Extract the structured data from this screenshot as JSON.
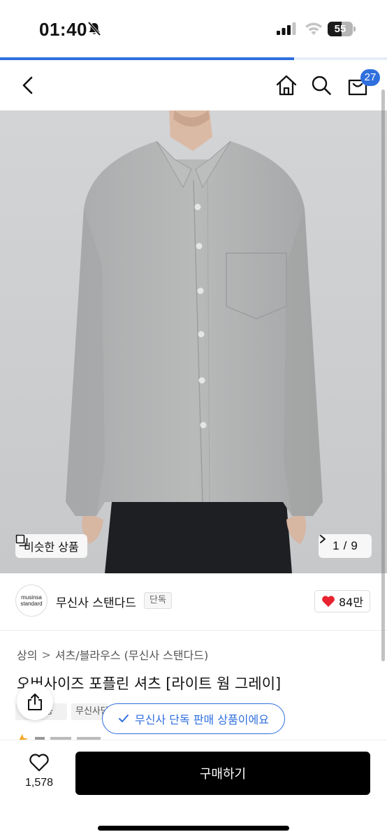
{
  "status_bar": {
    "time": "01:40",
    "battery_level": "55",
    "battery_fraction": 0.55,
    "icons": [
      "bell-slash-icon",
      "signal-icon",
      "wifi-icon",
      "battery-icon"
    ]
  },
  "page_load_progress": 0.76,
  "nav": {
    "icons": [
      "chevron-left-icon",
      "home-icon",
      "search-icon",
      "cart-icon"
    ],
    "cart_count": "27"
  },
  "gallery": {
    "similar_label": "비슷한 상품",
    "current": "1",
    "separator": "/",
    "total": "9"
  },
  "brand": {
    "logo_line1": "musinsa",
    "logo_line2": "standard",
    "name": "무신사 스탠다드",
    "exclusive_tag": "단독",
    "like_count": "84만"
  },
  "breadcrumb": {
    "level1": "상의",
    "level2": "셔츠/블라우스 (무신사 스탠다드)",
    "separator": ">"
  },
  "product": {
    "title": "오버사이즈 포플린 셔츠 [라이트 웜 그레이]",
    "tags": [
      "무료배송",
      "무신사단독"
    ]
  },
  "toast": {
    "text": "무신사 단독 판매 상품이에요"
  },
  "bottom_bar": {
    "wish_count": "1,578",
    "buy_label": "구매하기"
  },
  "colors": {
    "accent": "#2f6fde",
    "heart": "#e8232f",
    "buy_button": "#000000",
    "photo_background": "#ced0d2"
  }
}
